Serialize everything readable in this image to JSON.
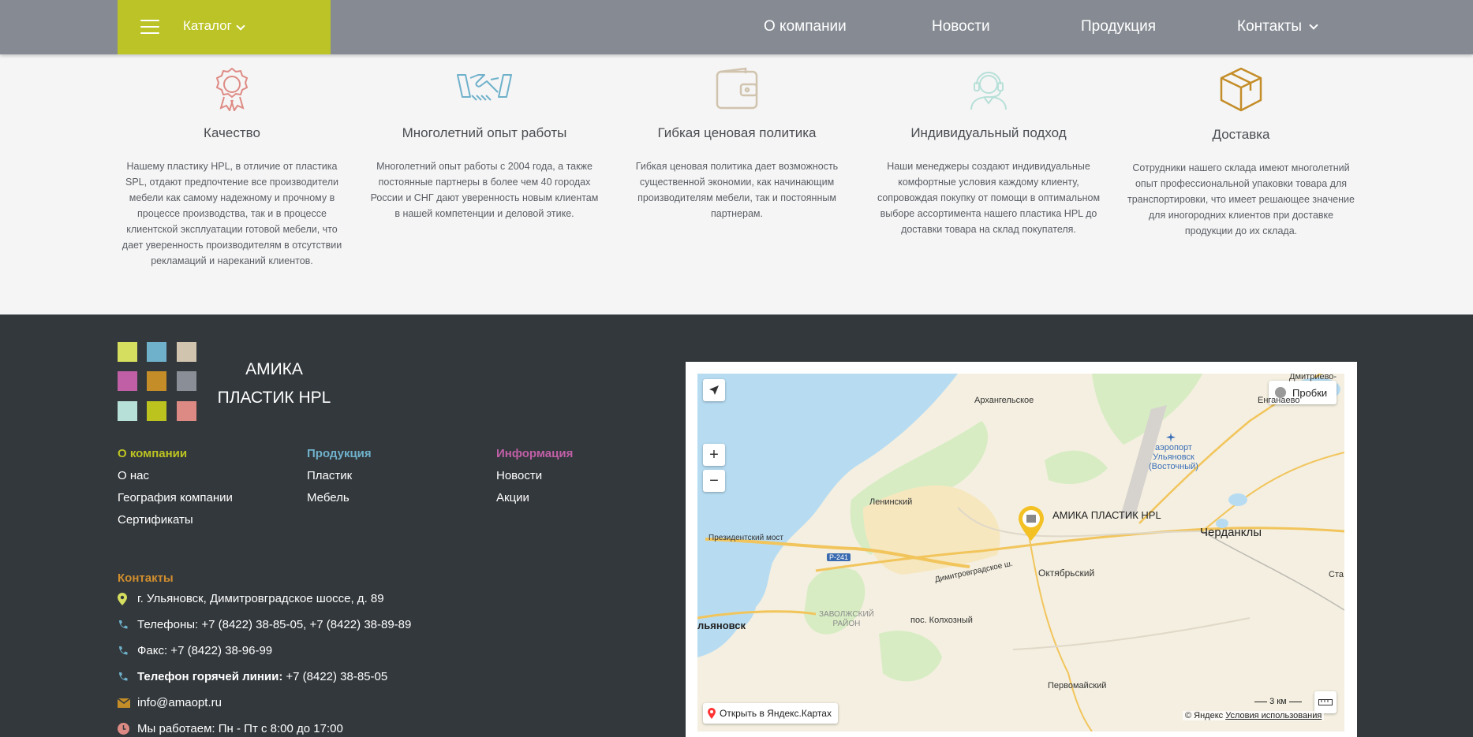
{
  "header": {
    "catalog_label": "Каталог",
    "nav": [
      {
        "label": "О компании"
      },
      {
        "label": "Новости"
      },
      {
        "label": "Продукция"
      },
      {
        "label": "Контакты"
      }
    ]
  },
  "features": [
    {
      "icon": "award-icon",
      "title": "Качество",
      "text": "Нашему пластику HPL, в отличие от пластика SPL, отдают предпочтение все производители мебели как самому надежному и прочному в процессе производства, так и в процессе клиентской эксплуатации готовой мебели, что дает уверенность производителям в отсутствии рекламаций и нареканий клиентов."
    },
    {
      "icon": "handshake-icon",
      "title": "Многолетний опыт работы",
      "text": "Многолетний опыт работы с 2004 года, а также постоянные партнеры в более чем 40 городах России и СНГ дают уверенность новым клиентам в нашей компетенции и деловой этике."
    },
    {
      "icon": "wallet-icon",
      "title": "Гибкая ценовая политика",
      "text": "Гибкая ценовая политика дает возможность существенной экономии, как начинающим производителям мебели, так и постоянным партнерам."
    },
    {
      "icon": "support-agent-icon",
      "title": "Индивидуальный подход",
      "text": "Наши менеджеры создают индивидуальные комфортные условия каждому клиенту, сопровождая покупку от помощи в оптимальном выборе ассортимента нашего пластика HPL до доставки товара на склад покупателя."
    },
    {
      "icon": "box-icon",
      "title": "Доставка",
      "text": "Сотрудники нашего склада имеют многолетний опыт профессиональной упаковки товара для транспортировки, что имеет решающее значение для иногородних клиентов при доставке продукции до их склада."
    }
  ],
  "footer": {
    "logo_line1": "АМИКА",
    "logo_line2": "ПЛАСТИК HPL",
    "logo_colors": [
      "#d5de5e",
      "#6fb1cb",
      "#d1c4ae",
      "#c05fa6",
      "#c48d28",
      "#8a8f97",
      "#b7e0d8",
      "#bcc31f",
      "#de8a84"
    ],
    "columns": [
      {
        "title": "О компании",
        "color": "#bcc322",
        "links": [
          "О нас",
          "География компании",
          "Сертификаты"
        ]
      },
      {
        "title": "Продукция",
        "color": "#6fb1cb",
        "links": [
          "Пластик",
          "Мебель"
        ]
      },
      {
        "title": "Информация",
        "color": "#c05fa6",
        "links": [
          "Новости",
          "Акции"
        ]
      }
    ],
    "contacts_title": "Контакты",
    "address": "г. Ульяновск, Димитровградское шоссе, д. 89",
    "phones": "Телефоны: +7 (8422) 38-85-05, +7 (8422) 38-89-89",
    "fax": "Факс: +7 (8422) 38-96-99",
    "hotline_label": "Телефон горячей линии:",
    "hotline_value": "+7 (8422) 38-85-05",
    "email": "info@amaopt.ru",
    "hours": "Мы работаем: Пн - Пт с 8:00 до 17:00"
  },
  "map": {
    "traffic_label": "Пробки",
    "marker_label": "АМИКА ПЛАСТИК HPL",
    "open_label": "Открыть в Яндекс.Картах",
    "copyright": "© Яндекс",
    "terms": "Условия использования",
    "scale": "3 км",
    "places": {
      "arkhangelskoe": "Архангельское",
      "dimitrievo": "Дмитриево-",
      "enganaevo": "Енганаево",
      "airport1": "аэропорт",
      "airport2": "Ульяновск",
      "airport3": "(Восточный)",
      "leninsky": "Ленинский",
      "prezident": "Президентский мост",
      "r241": "Р-241",
      "cherdakly": "Черданклы",
      "oktyabrsky": "Октябрьский",
      "dimitrovgrad_sh": "Димитровградское ш.",
      "zavolzh1": "ЗАВОЛЖСКИЙ",
      "zavolzh2": "РАЙОН",
      "kolkhozny": "пос. Колхозный",
      "ulyanovsk": "льяновск",
      "pervomaisky": "Первомайский",
      "sta": "Ста"
    }
  }
}
